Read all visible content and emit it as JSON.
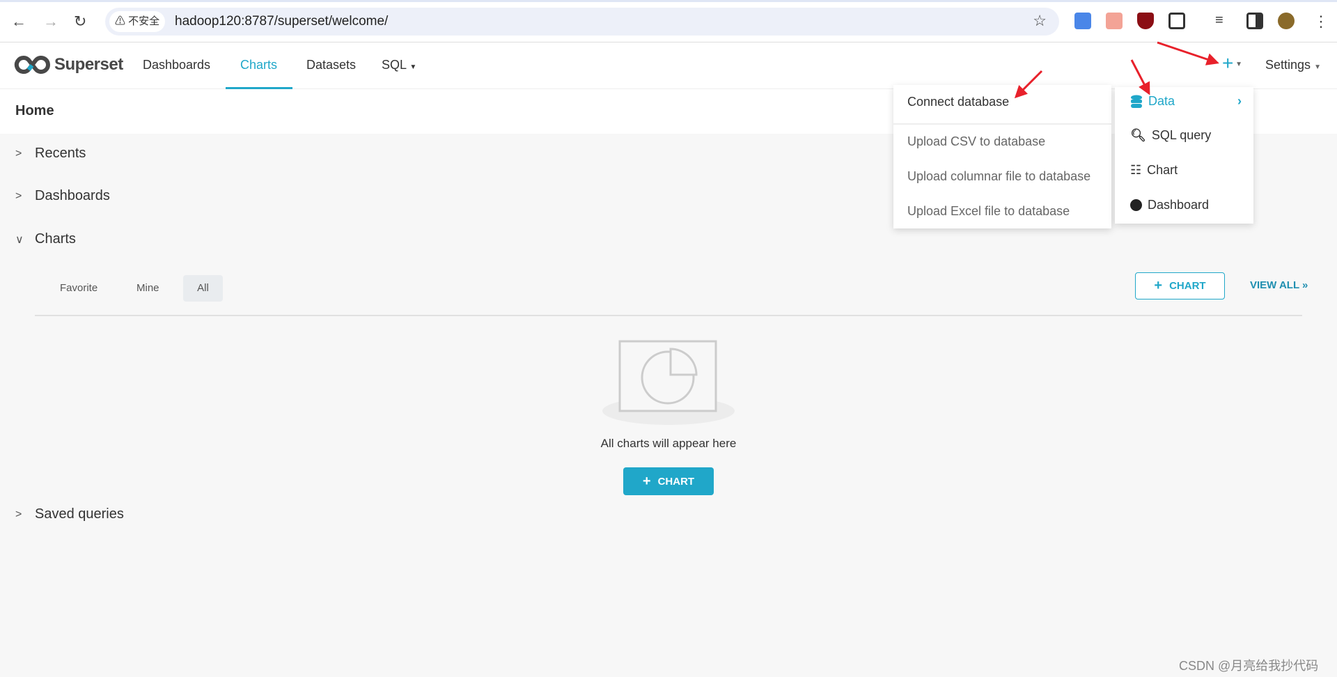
{
  "browser": {
    "security_label": "不安全",
    "url": "hadoop120:8787/superset/welcome/"
  },
  "nav": {
    "brand": "Superset",
    "items": [
      {
        "label": "Dashboards"
      },
      {
        "label": "Charts",
        "active": true
      },
      {
        "label": "Datasets"
      },
      {
        "label": "SQL"
      }
    ],
    "plus": "+",
    "settings": "Settings"
  },
  "page": {
    "title": "Home"
  },
  "sections": {
    "recents": "Recents",
    "dashboards": "Dashboards",
    "charts": "Charts",
    "saved_queries": "Saved queries"
  },
  "charts_panel": {
    "tabs": [
      "Favorite",
      "Mine",
      "All"
    ],
    "selected_tab": "All",
    "add_chart": "CHART",
    "view_all": "VIEW ALL »",
    "empty_text": "All charts will appear here",
    "empty_button": "CHART"
  },
  "data_submenu": {
    "items": [
      "Connect database",
      "Upload CSV to database",
      "Upload columnar file to database",
      "Upload Excel file to database"
    ]
  },
  "new_menu": {
    "items": [
      {
        "label": "Data",
        "icon": "database-icon"
      },
      {
        "label": "SQL query",
        "icon": "search-icon"
      },
      {
        "label": "Chart",
        "icon": "bar-chart-icon"
      },
      {
        "label": "Dashboard",
        "icon": "dashboard-icon"
      }
    ]
  },
  "colors": {
    "accent": "#20a7c9",
    "arrow": "#e8212b"
  },
  "watermark": "CSDN @月亮给我抄代码"
}
